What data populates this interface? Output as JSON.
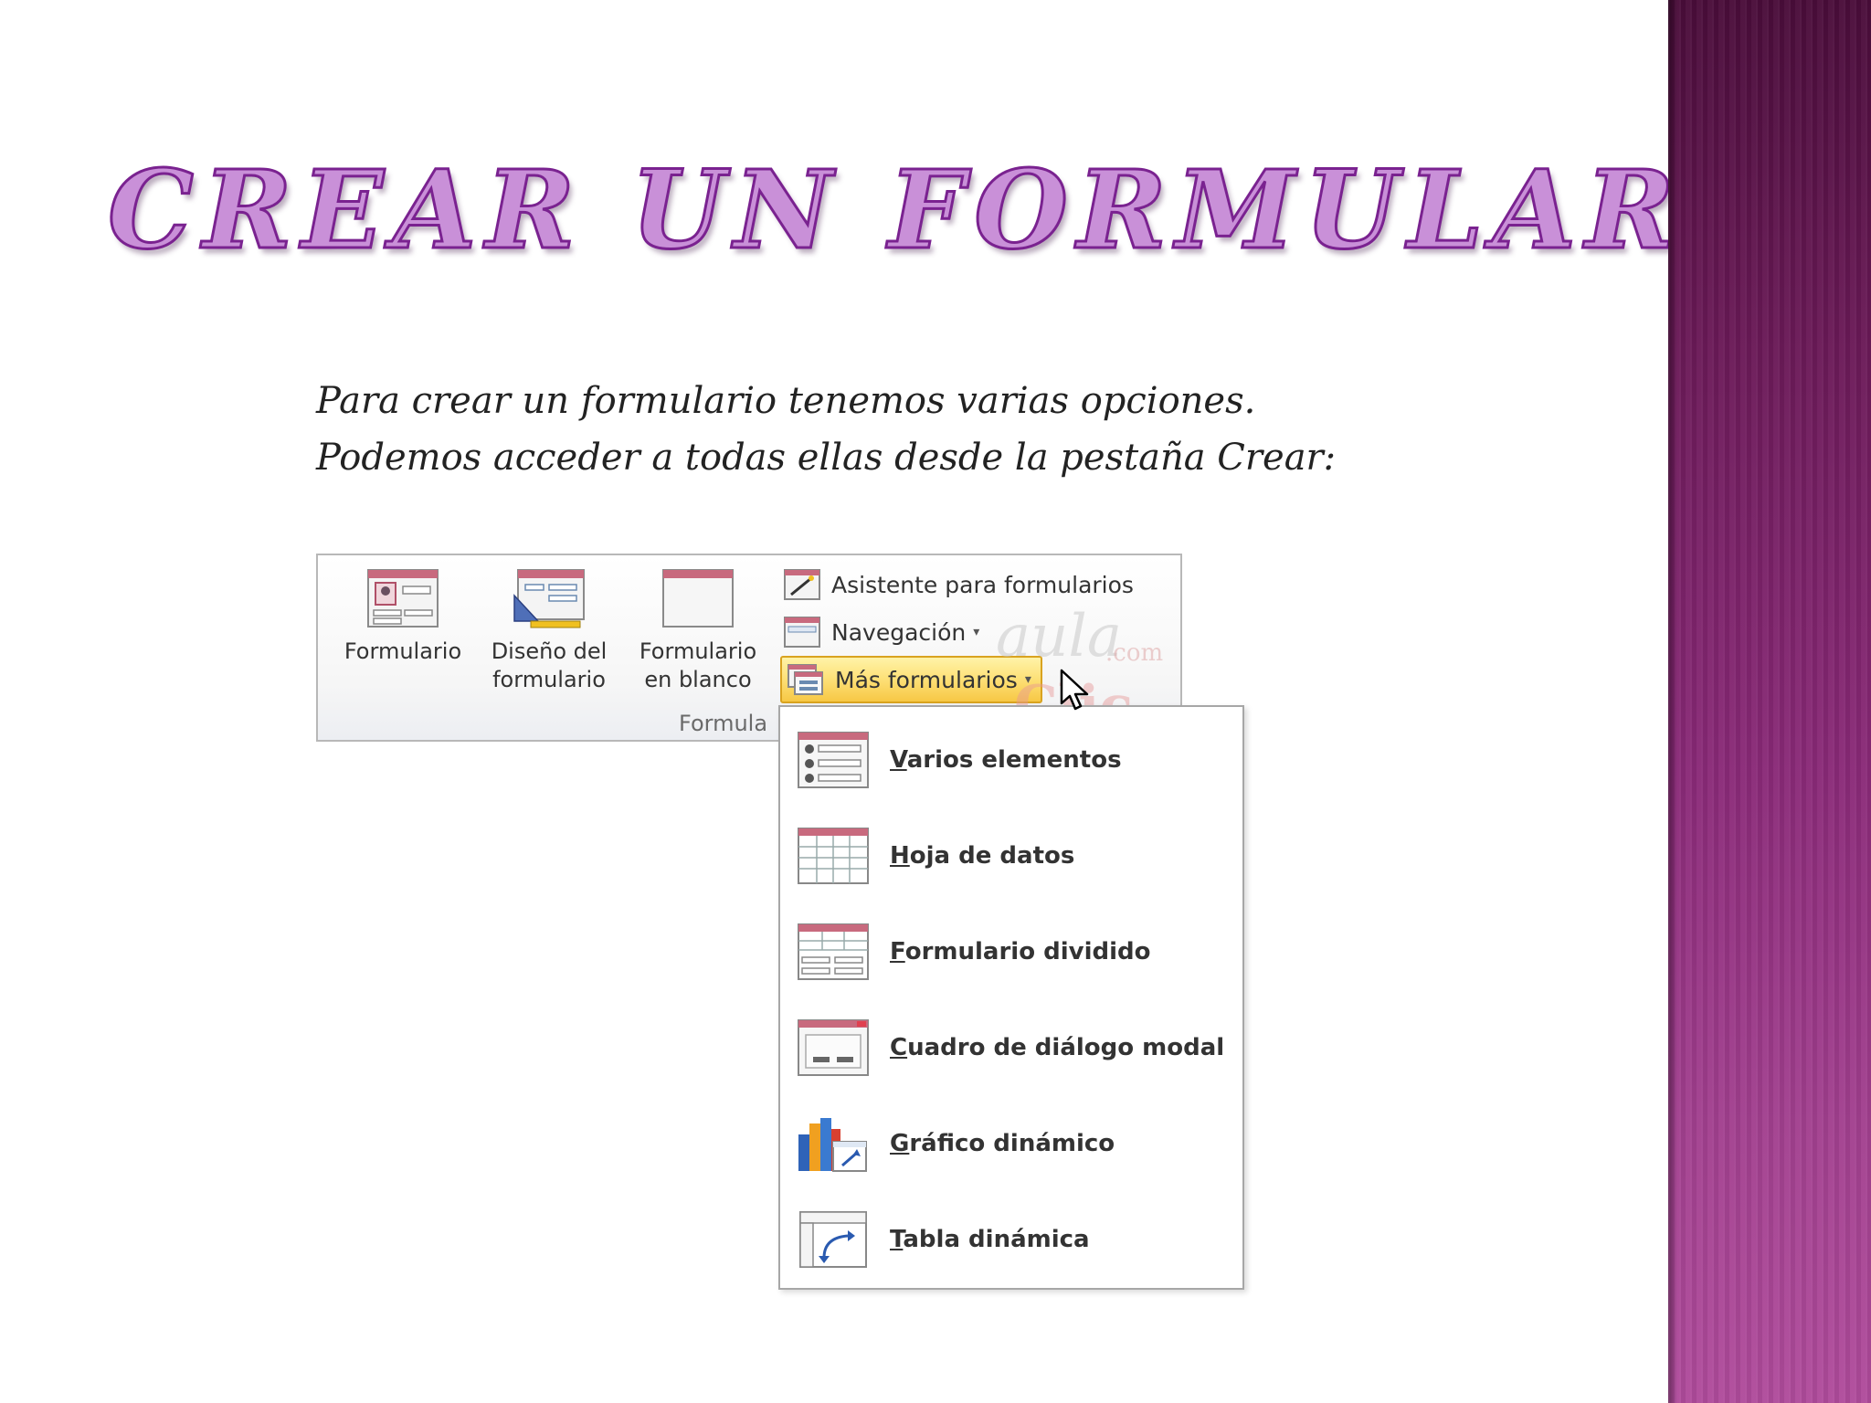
{
  "slide": {
    "title": "Crear un formulario",
    "lines": [
      "Para crear un formulario tenemos varias opciones.",
      "Podemos acceder a todas ellas desde la pestaña Crear:"
    ]
  },
  "ribbon": {
    "buttons": [
      {
        "line1": "Formulario",
        "line2": "",
        "icon": "form-icon"
      },
      {
        "line1": "Diseño del",
        "line2": "formulario",
        "icon": "form-design-icon"
      },
      {
        "line1": "Formulario",
        "line2": "en blanco",
        "icon": "blank-form-icon"
      }
    ],
    "small_buttons": [
      {
        "label": "Asistente para formularios",
        "icon": "form-wizard-icon"
      },
      {
        "label": "Navegación",
        "icon": "navigation-icon",
        "caret": "▾"
      },
      {
        "label": "Más formularios",
        "icon": "more-forms-icon",
        "caret": "▾"
      }
    ],
    "group_label": "Formula"
  },
  "watermark": {
    "text": "aula",
    "com": ".com",
    "clic": "Clic"
  },
  "menu": {
    "items": [
      {
        "key": "V",
        "rest": "arios elementos",
        "icon": "multiple-items-icon"
      },
      {
        "key": "H",
        "rest": "oja de datos",
        "icon": "datasheet-icon"
      },
      {
        "key": "F",
        "rest": "ormulario dividido",
        "icon": "split-form-icon"
      },
      {
        "key": "C",
        "rest": "uadro de diálogo modal",
        "icon": "modal-dialog-icon"
      },
      {
        "key": "G",
        "rest": "ráfico dinámico",
        "icon": "pivot-chart-icon"
      },
      {
        "key": "T",
        "rest": "abla dinámica",
        "icon": "pivot-table-icon"
      }
    ]
  },
  "colors": {
    "accent": "#7a2290",
    "sidebar": "#8a2a78",
    "highlight": "#fde076"
  }
}
